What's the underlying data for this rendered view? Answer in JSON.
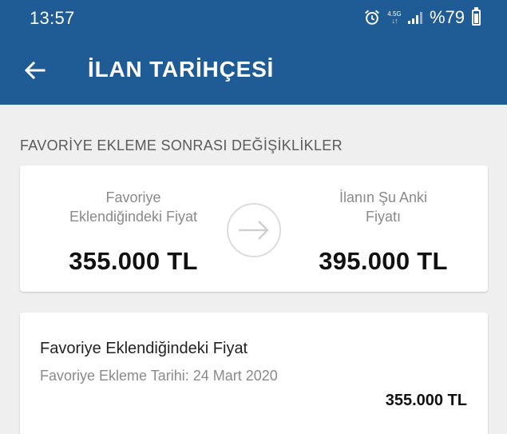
{
  "status_bar": {
    "time": "13:57",
    "network": "4.5G",
    "battery": "%79",
    "icons": [
      "alarm-icon",
      "network-icon",
      "signal-icon",
      "battery-icon"
    ]
  },
  "app_bar": {
    "title": "İLAN TARİHÇESİ",
    "back_icon": "back-arrow-icon",
    "color": "#1f5b94"
  },
  "section": {
    "heading": "FAVORİYE EKLEME SONRASI DEĞİŞİKLİKLER"
  },
  "comparison": {
    "left_label_line1": "Favoriye",
    "left_label_line2": "Eklendiğindeki Fiyat",
    "left_price": "355.000 TL",
    "right_label_line1": "İlanın Şu Anki",
    "right_label_line2": "Fiyatı",
    "right_price": "395.000 TL",
    "arrow_icon": "arrow-right-icon"
  },
  "history_item": {
    "title": "Favoriye Eklendiğindeki Fiyat",
    "date": "Favoriye Ekleme Tarihi: 24 Mart 2020",
    "price": "355.000 TL"
  }
}
